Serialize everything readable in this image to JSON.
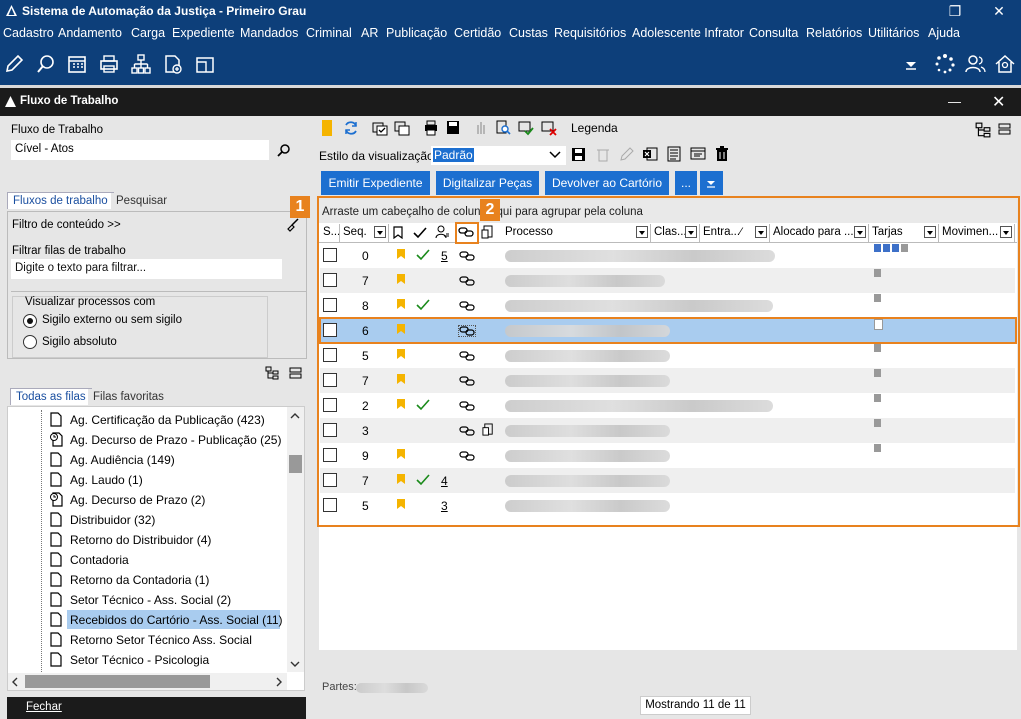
{
  "window": {
    "title": "Sistema de Automação da Justiça - Primeiro Grau",
    "restore_glyph": "❐",
    "close_glyph": "✕"
  },
  "menu": [
    "Cadastro",
    "Andamento",
    "Carga",
    "Expediente",
    "Mandados",
    "Criminal",
    "AR",
    "Publicação",
    "Certidão",
    "Custas",
    "Requisitórios",
    "Adolescente Infrator",
    "Consulta",
    "Relatórios",
    "Utilitários",
    "Ajuda"
  ],
  "panel": {
    "title": "Fluxo de Trabalho",
    "close_glyph": "✕",
    "minimize_glyph": "—"
  },
  "left": {
    "fluxo_label": "Fluxo de Trabalho",
    "fluxo_value": "Cível - Atos",
    "tabs": [
      "Fluxos de trabalho",
      "Pesquisar"
    ],
    "filtro_conteudo": "Filtro de conteúdo >>",
    "filtrar_label": "Filtrar filas de trabalho",
    "filtrar_placeholder": "Digite o texto para filtrar...",
    "visualizar_label": "Visualizar processos com",
    "radio1": "Sigilo externo ou sem sigilo",
    "radio2": "Sigilo absoluto",
    "queue_tabs": [
      "Todas as filas",
      "Filas favoritas"
    ],
    "queues": [
      "Ag. Certificação da Publicação (423)",
      "Ag. Decurso de Prazo - Publicação (25)",
      "Ag. Audiência (149)",
      "Ag. Laudo (1)",
      "Ag. Decurso de Prazo (2)",
      "Distribuidor (32)",
      "Retorno do Distribuidor (4)",
      "Contadoria",
      "Retorno da Contadoria (1)",
      "Setor Técnico - Ass. Social (2)",
      "Recebidos do Cartório - Ass. Social (11)",
      "Retorno Setor Técnico Ass. Social",
      "Setor Técnico - Psicologia"
    ],
    "close_button": "Fechar"
  },
  "right": {
    "legenda": "Legenda",
    "estilo_label": "Estilo da visualização",
    "estilo_value": "Padrão",
    "buttons": [
      "Emitir Expediente",
      "Digitalizar Peças",
      "Devolver ao Cartório",
      "..."
    ],
    "group_hint": "Arraste um cabeçalho de coluna aqui para agrupar pela coluna",
    "columns": [
      "S...",
      "Seq.",
      "Processo",
      "Clas...",
      "Entra...",
      "Alocado para ...",
      "Tarjas",
      "Movimen..."
    ],
    "rows": [
      {
        "seq": "0",
        "flag": true,
        "check": true,
        "num": "5",
        "link": true
      },
      {
        "seq": "7",
        "flag": true,
        "check": false,
        "num": "",
        "link": true
      },
      {
        "seq": "8",
        "flag": true,
        "check": true,
        "num": "",
        "link": true
      },
      {
        "seq": "6",
        "flag": true,
        "check": false,
        "num": "",
        "link": true
      },
      {
        "seq": "5",
        "flag": true,
        "check": false,
        "num": "",
        "link": true
      },
      {
        "seq": "7",
        "flag": true,
        "check": false,
        "num": "",
        "link": true
      },
      {
        "seq": "2",
        "flag": true,
        "check": true,
        "num": "",
        "link": true
      },
      {
        "seq": "3",
        "flag": false,
        "check": false,
        "num": "",
        "link": true
      },
      {
        "seq": "9",
        "flag": true,
        "check": false,
        "num": "",
        "link": true
      },
      {
        "seq": "7",
        "flag": true,
        "check": true,
        "num": "4",
        "link": false
      },
      {
        "seq": "5",
        "flag": true,
        "check": false,
        "num": "3",
        "link": false
      }
    ],
    "partes_label": "Partes:",
    "status": "Mostrando 11 de 11",
    "badge1": "1",
    "badge2": "2"
  },
  "colors": {
    "titlebar": "#0d3f7a",
    "accent_button": "#1c6fd0",
    "highlight_border": "#e8821e",
    "selection": "#a9ccef"
  }
}
